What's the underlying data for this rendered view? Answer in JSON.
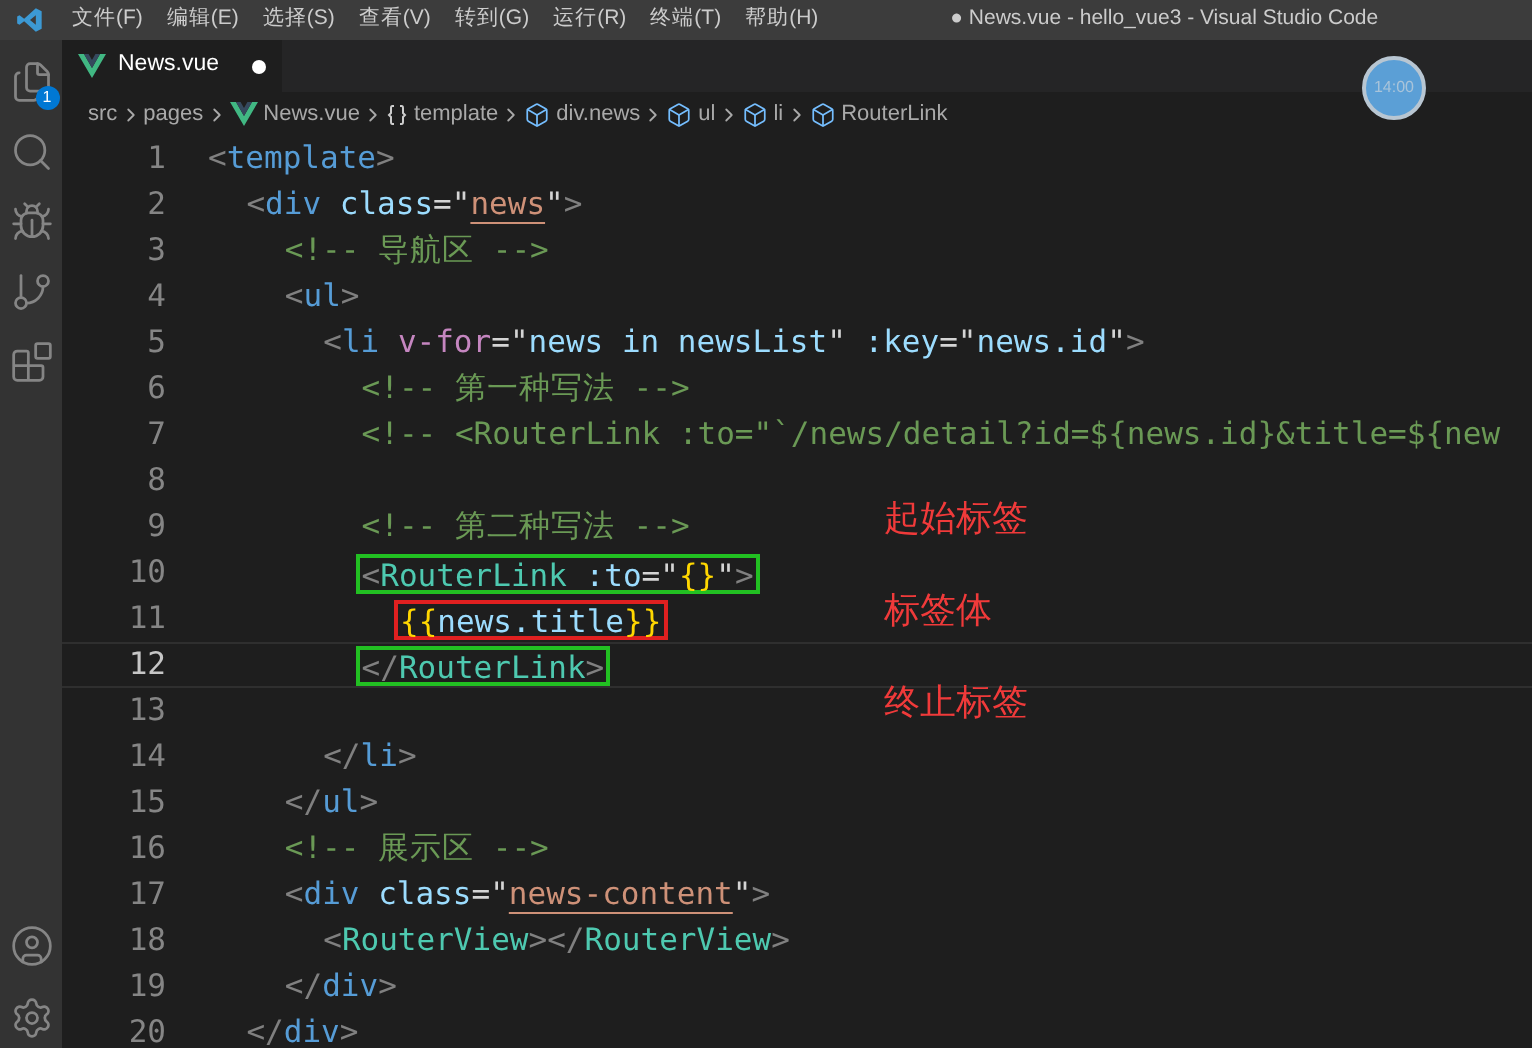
{
  "menu": [
    "文件(F)",
    "编辑(E)",
    "选择(S)",
    "查看(V)",
    "转到(G)",
    "运行(R)",
    "终端(T)",
    "帮助(H)"
  ],
  "window": {
    "title": "● News.vue - hello_vue3 - Visual Studio Code"
  },
  "activity_bar": [
    {
      "kind": "files",
      "badge": "1"
    },
    {
      "kind": "search"
    },
    {
      "kind": "run"
    },
    {
      "kind": "source-control"
    },
    {
      "kind": "extensions"
    }
  ],
  "activity_bar_bottom": [
    {
      "kind": "account"
    },
    {
      "kind": "settings"
    }
  ],
  "tabs": [
    {
      "label": "News.vue",
      "selected": true,
      "modified": true
    }
  ],
  "breadcrumbs": [
    {
      "label": "src",
      "kind": "folder"
    },
    {
      "label": "pages",
      "kind": "folder"
    },
    {
      "label": "News.vue",
      "kind": "vue"
    },
    {
      "label": "template",
      "kind": "braces"
    },
    {
      "label": "div.news",
      "kind": "element"
    },
    {
      "label": "ul",
      "kind": "element"
    },
    {
      "label": "li",
      "kind": "element"
    },
    {
      "label": "RouterLink",
      "kind": "element"
    }
  ],
  "clock": "14:00",
  "code_lines": [
    {
      "number": "1",
      "tokens": [
        {
          "kind": "p",
          "text": "<"
        },
        {
          "kind": "tag",
          "text": "template"
        },
        {
          "kind": "p",
          "text": ">"
        }
      ],
      "children": [
        {
          "number": "2",
          "tokens": [
            {
              "kind": "p",
              "text": "<"
            },
            {
              "kind": "tag",
              "text": "div"
            },
            {
              "kind": "attr",
              "text": " class"
            },
            {
              "kind": "t",
              "text": "=\""
            },
            {
              "kind": "str",
              "text": "news"
            },
            {
              "kind": "t",
              "text": "\""
            },
            {
              "kind": "p",
              "text": ">"
            }
          ],
          "children": [
            {
              "number": "3",
              "tokens": [
                {
                  "kind": "com",
                  "text": "<!-- 导航区 -->"
                }
              ]
            },
            {
              "number": "4",
              "tokens": [
                {
                  "kind": "p",
                  "text": "<"
                },
                {
                  "kind": "tag",
                  "text": "ul"
                },
                {
                  "kind": "p",
                  "text": ">"
                }
              ],
              "children": [
                {
                  "number": "5",
                  "tokens": [
                    {
                      "kind": "p",
                      "text": "<"
                    },
                    {
                      "kind": "tag",
                      "text": "li"
                    },
                    {
                      "kind": "dir",
                      "text": " v-for"
                    },
                    {
                      "kind": "t",
                      "text": "=\""
                    },
                    {
                      "kind": "attr",
                      "text": "news in newsList"
                    },
                    {
                      "kind": "t",
                      "text": "\" "
                    },
                    {
                      "kind": "attr",
                      "text": ":key"
                    },
                    {
                      "kind": "t",
                      "text": "=\""
                    },
                    {
                      "kind": "attr",
                      "text": "news.id"
                    },
                    {
                      "kind": "t",
                      "text": "\""
                    },
                    {
                      "kind": "p",
                      "text": ">"
                    }
                  ],
                  "children": [
                    {
                      "number": "6",
                      "tokens": [
                        {
                          "kind": "com",
                          "text": "<!-- 第一种写法 -->"
                        }
                      ]
                    },
                    {
                      "number": "7",
                      "tokens": [
                        {
                          "kind": "com",
                          "text": "<!-- <RouterLink :to=\"`/news/detail?id=${news.id}&title=${new"
                        }
                      ]
                    },
                    {
                      "number": "8"
                    },
                    {
                      "number": "9",
                      "tokens": [
                        {
                          "kind": "com",
                          "text": "<!-- 第二种写法 -->"
                        }
                      ],
                      "note": "起始标签"
                    },
                    {
                      "number": "10",
                      "tokens": [
                        {
                          "kind": "p",
                          "text": "<"
                        },
                        {
                          "kind": "comp",
                          "text": "RouterLink"
                        },
                        {
                          "kind": "attr",
                          "text": " :to"
                        },
                        {
                          "kind": "t",
                          "text": "=\""
                        },
                        {
                          "kind": "brace",
                          "text": "{}"
                        },
                        {
                          "kind": "t",
                          "text": "\""
                        },
                        {
                          "kind": "p",
                          "text": ">"
                        }
                      ],
                      "color": "#22c022",
                      "children": [
                        {
                          "number": "11",
                          "tokens": [
                            {
                              "kind": "brace",
                              "text": "{{"
                            },
                            {
                              "kind": "attr",
                              "text": "news.title"
                            },
                            {
                              "kind": "brace",
                              "text": "}}"
                            }
                          ],
                          "color": "#e02020",
                          "note": "标签体"
                        }
                      ]
                    },
                    {
                      "number": "12",
                      "tokens": [
                        {
                          "kind": "p",
                          "text": "</"
                        },
                        {
                          "kind": "comp",
                          "text": "RouterLink"
                        },
                        {
                          "kind": "p",
                          "text": ">"
                        }
                      ],
                      "color": "#22c022",
                      "current": true
                    },
                    {
                      "number": "13",
                      "note": "终止标签"
                    }
                  ]
                },
                {
                  "number": "14",
                  "tokens": [
                    {
                      "kind": "p",
                      "text": "</"
                    },
                    {
                      "kind": "tag",
                      "text": "li"
                    },
                    {
                      "kind": "p",
                      "text": ">"
                    }
                  ]
                }
              ]
            },
            {
              "number": "15",
              "tokens": [
                {
                  "kind": "p",
                  "text": "</"
                },
                {
                  "kind": "tag",
                  "text": "ul"
                },
                {
                  "kind": "p",
                  "text": ">"
                }
              ]
            },
            {
              "number": "16",
              "tokens": [
                {
                  "kind": "com",
                  "text": "<!-- 展示区 -->"
                }
              ]
            },
            {
              "number": "17",
              "tokens": [
                {
                  "kind": "p",
                  "text": "<"
                },
                {
                  "kind": "tag",
                  "text": "div"
                },
                {
                  "kind": "attr",
                  "text": " class"
                },
                {
                  "kind": "t",
                  "text": "=\""
                },
                {
                  "kind": "str",
                  "text": "news-content"
                },
                {
                  "kind": "t",
                  "text": "\""
                },
                {
                  "kind": "p",
                  "text": ">"
                }
              ],
              "children": [
                {
                  "number": "18",
                  "tokens": [
                    {
                      "kind": "p",
                      "text": "<"
                    },
                    {
                      "kind": "comp",
                      "text": "RouterView"
                    },
                    {
                      "kind": "p",
                      "text": "></"
                    },
                    {
                      "kind": "comp",
                      "text": "RouterView"
                    },
                    {
                      "kind": "p",
                      "text": ">"
                    }
                  ]
                }
              ]
            },
            {
              "number": "19",
              "tokens": [
                {
                  "kind": "p",
                  "text": "</"
                },
                {
                  "kind": "tag",
                  "text": "div"
                },
                {
                  "kind": "p",
                  "text": ">"
                }
              ]
            }
          ]
        },
        {
          "number": "20",
          "tokens": [
            {
              "kind": "p",
              "text": "</"
            },
            {
              "kind": "tag",
              "text": "div"
            },
            {
              "kind": "p",
              "text": ">"
            }
          ]
        }
      ]
    }
  ]
}
